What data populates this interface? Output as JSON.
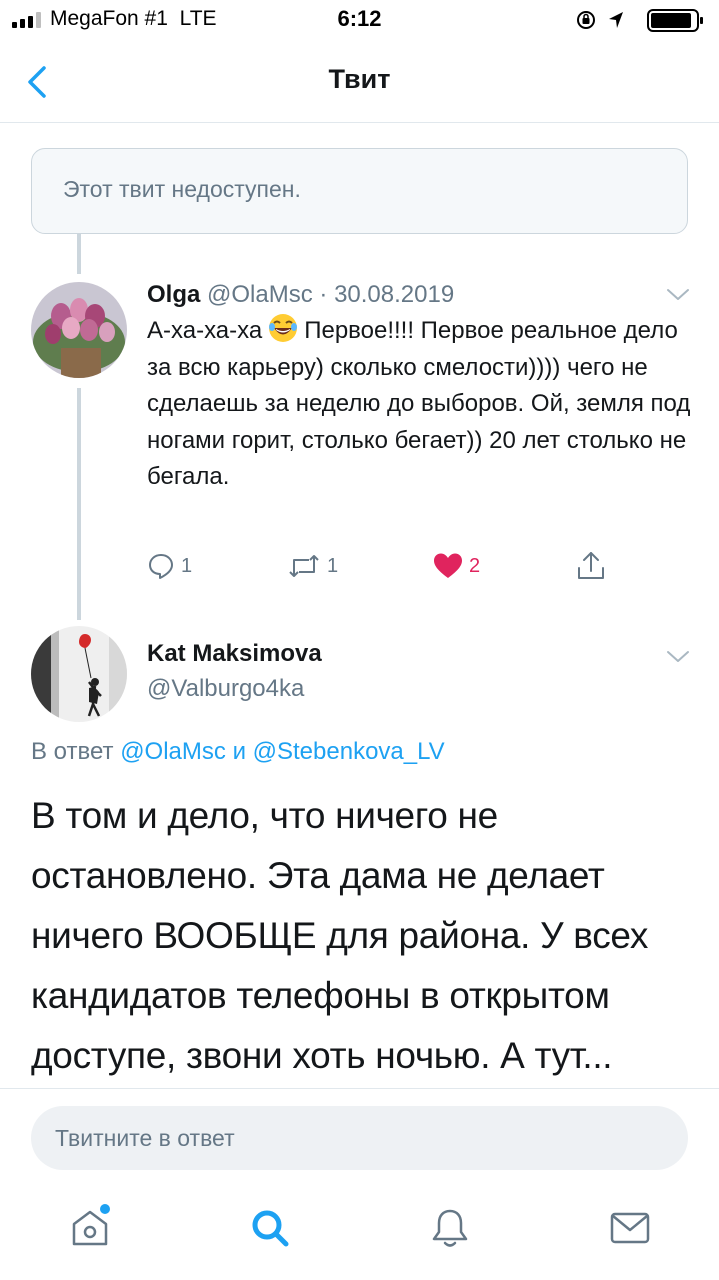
{
  "status_bar": {
    "carrier": "MegaFon #1",
    "network": "LTE",
    "time": "6:12"
  },
  "nav": {
    "title": "Твит"
  },
  "unavailable_notice": "Этот твит недоступен.",
  "parent_tweet": {
    "name": "Olga",
    "handle": "@OlaMsc",
    "separator": "·",
    "date": "30.08.2019",
    "text_before_emoji": "А-ха-ха-ха",
    "emoji": "laughing-tears-emoji",
    "text_after_emoji": "Первое!!!! Первое реальное дело за всю карьеру) сколько смелости)))) чего не сделаешь за неделю до выборов. Ой, земля под ногами горит, столько бегает)) 20 лет столько не бегала.",
    "reply_count": "1",
    "retweet_count": "1",
    "like_count": "2",
    "liked": true,
    "like_color": "#e0245e"
  },
  "focused_tweet": {
    "name": "Kat Maksimova",
    "handle": "@Valburgo4ka",
    "reply_prefix": "В ответ",
    "reply_mention_1": "@OlaMsc",
    "reply_conjunction": "и",
    "reply_mention_2": "@Stebenkova_LV",
    "text": "В том и дело, что ничего не остановлено. Эта дама не делает ничего ВООБЩЕ для района. У всех кандидатов телефоны в открытом доступе, звони хоть ночью. А тут..."
  },
  "composer": {
    "placeholder": "Твитните в ответ"
  },
  "tab_bar": {
    "items": [
      "home-icon",
      "search-icon",
      "notifications-icon",
      "messages-icon"
    ],
    "active": "search-icon",
    "accent": "#1da1f2"
  }
}
